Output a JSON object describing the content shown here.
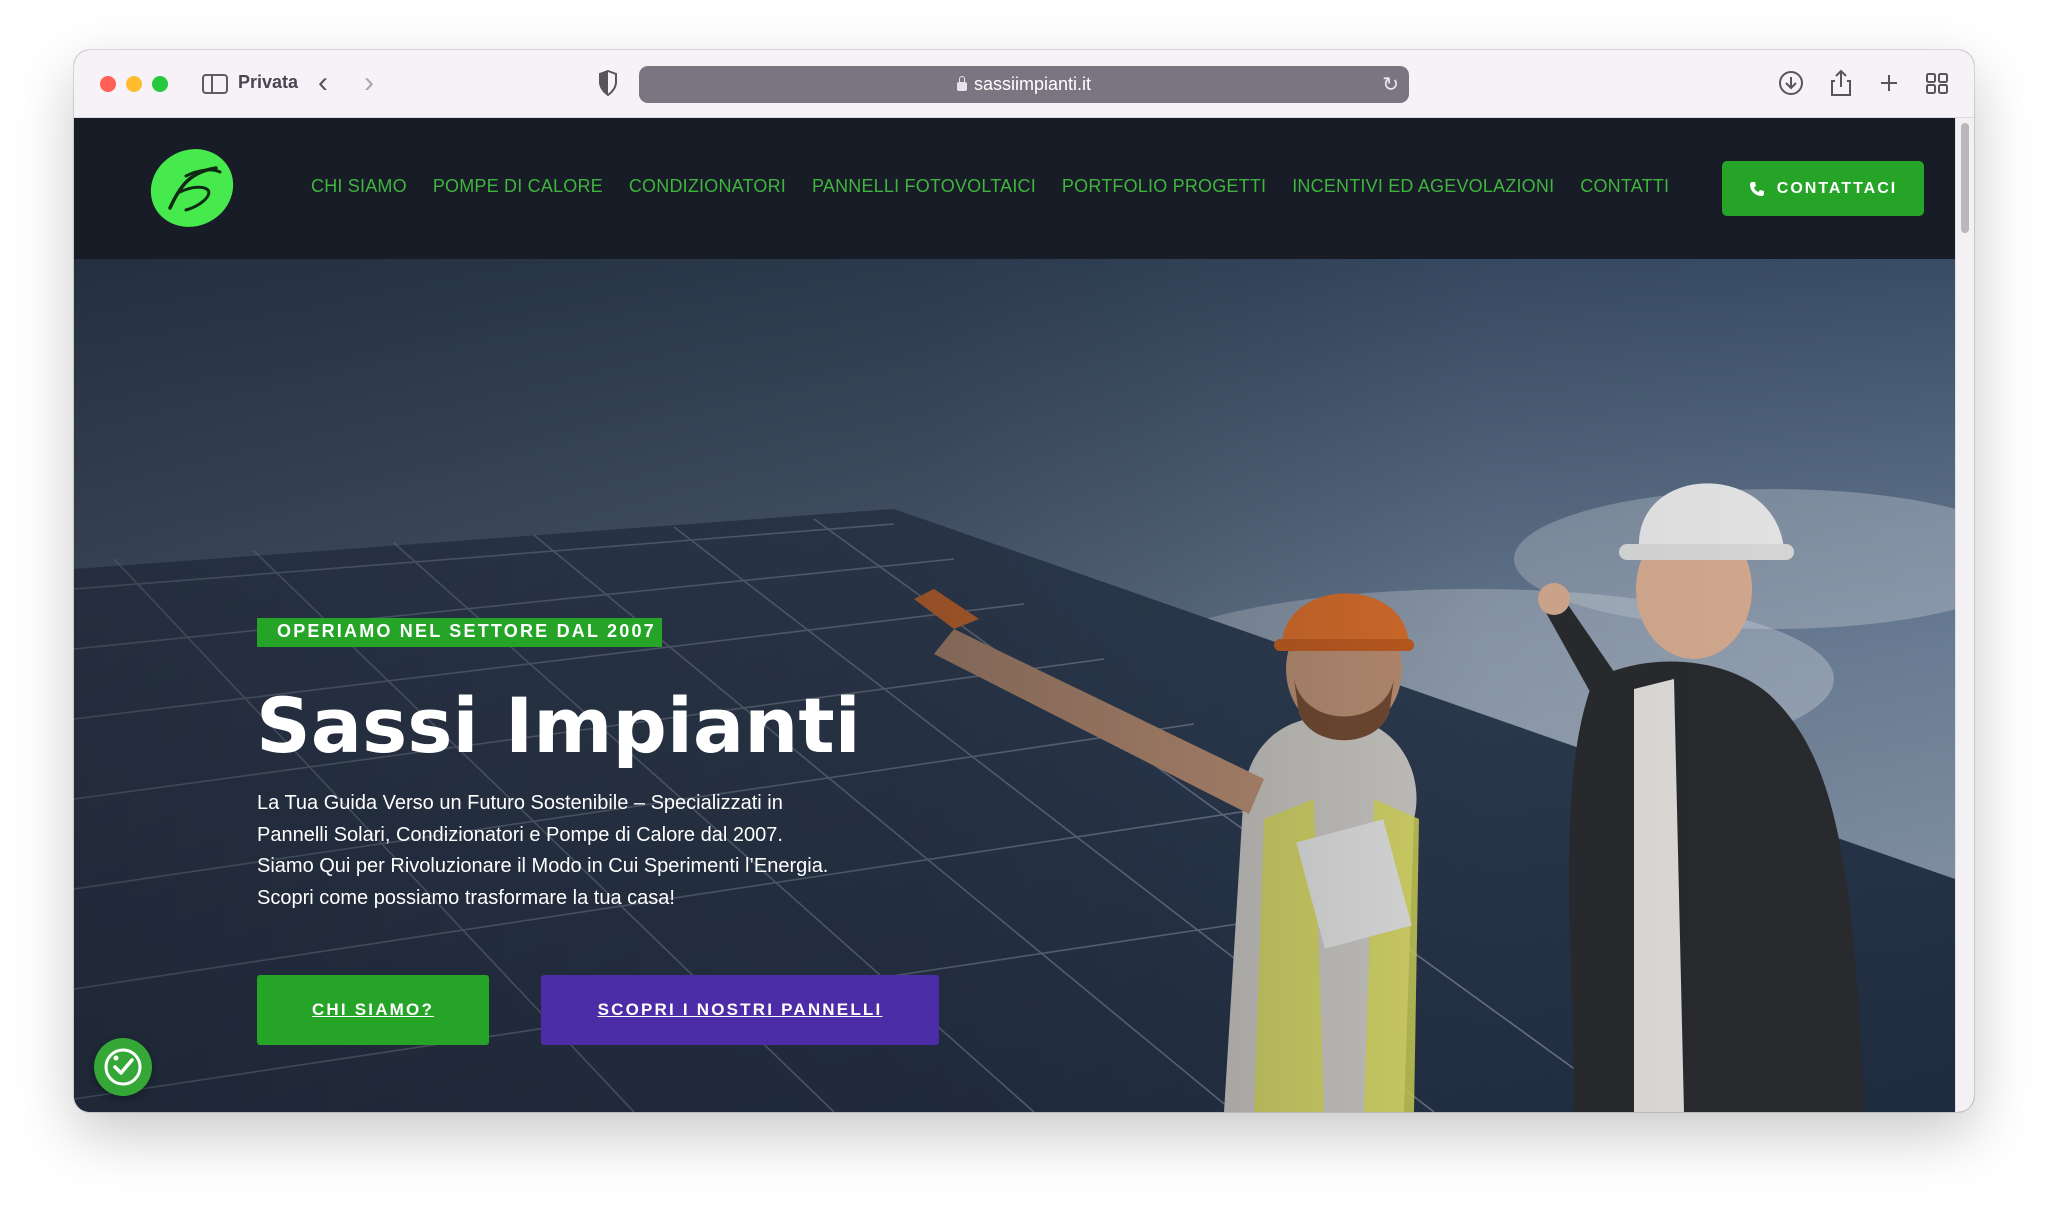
{
  "browser": {
    "mode_label": "Privata",
    "url": "sassiimpianti.it"
  },
  "site": {
    "nav": [
      {
        "label": "CHI SIAMO"
      },
      {
        "label": "POMPE DI CALORE"
      },
      {
        "label": "CONDIZIONATORI"
      },
      {
        "label": "PANNELLI FOTOVOLTAICI"
      },
      {
        "label": "PORTFOLIO PROGETTI"
      },
      {
        "label": "INCENTIVI ED AGEVOLAZIONI"
      },
      {
        "label": "CONTATTI"
      }
    ],
    "cta_label": "CONTATTACI"
  },
  "hero": {
    "tagline": "OPERIAMO NEL SETTORE DAL 2007",
    "title": "Sassi Impianti",
    "description": [
      "La Tua Guida Verso un Futuro Sostenibile – Specializzati in",
      "Pannelli Solari, Condizionatori e Pompe di Calore dal 2007.",
      "Siamo Qui per Rivoluzionare il Modo in Cui Sperimenti l’Energia.",
      "Scopri come possiamo trasformare la tua casa!"
    ],
    "btn_primary": "CHI SIAMO?",
    "btn_secondary": "SCOPRI I NOSTRI PANNELLI"
  },
  "colors": {
    "brand_green": "#26a428",
    "nav_green": "#3fb53d",
    "header_bg": "#181c27",
    "accent_purple": "#4d2da7"
  },
  "icons": {
    "logo": "sassi-impianti-logo",
    "phone": "phone-icon",
    "accessibility": "accessibility-icon"
  }
}
